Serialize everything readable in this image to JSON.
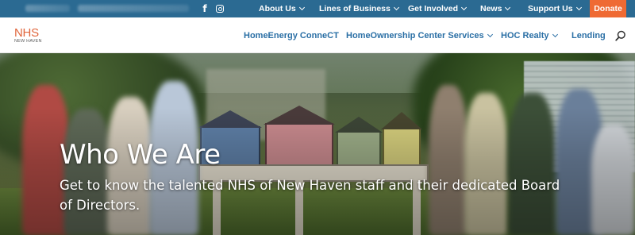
{
  "topbar": {
    "social": {
      "facebook_glyph": "f",
      "facebook_icon": "facebook-icon",
      "instagram_icon": "instagram-icon"
    },
    "nav": [
      {
        "label": "About Us"
      },
      {
        "label": "Lines of Business"
      },
      {
        "label": "Get Involved"
      },
      {
        "label": "News"
      },
      {
        "label": "Support Us"
      }
    ],
    "donate_label": "Donate",
    "colors": {
      "background": "#2b6a92",
      "donate": "#ef6a33"
    }
  },
  "header": {
    "logo": {
      "main": "NHS",
      "sub": "NEW HAVEN"
    },
    "nav": [
      {
        "label": "HomeEnergy ConneCT"
      },
      {
        "label": "HomeOwnership Center Services"
      },
      {
        "label": "HOC Realty"
      },
      {
        "label": "Lending"
      }
    ],
    "search_icon": "search-icon",
    "colors": {
      "nav_text": "#2a6fa5",
      "logo": "#e0653b"
    }
  },
  "hero": {
    "title": "Who We Are",
    "subtitle": "Get to know the talented NHS of New Haven staff and their dedicated Board of Directors."
  }
}
